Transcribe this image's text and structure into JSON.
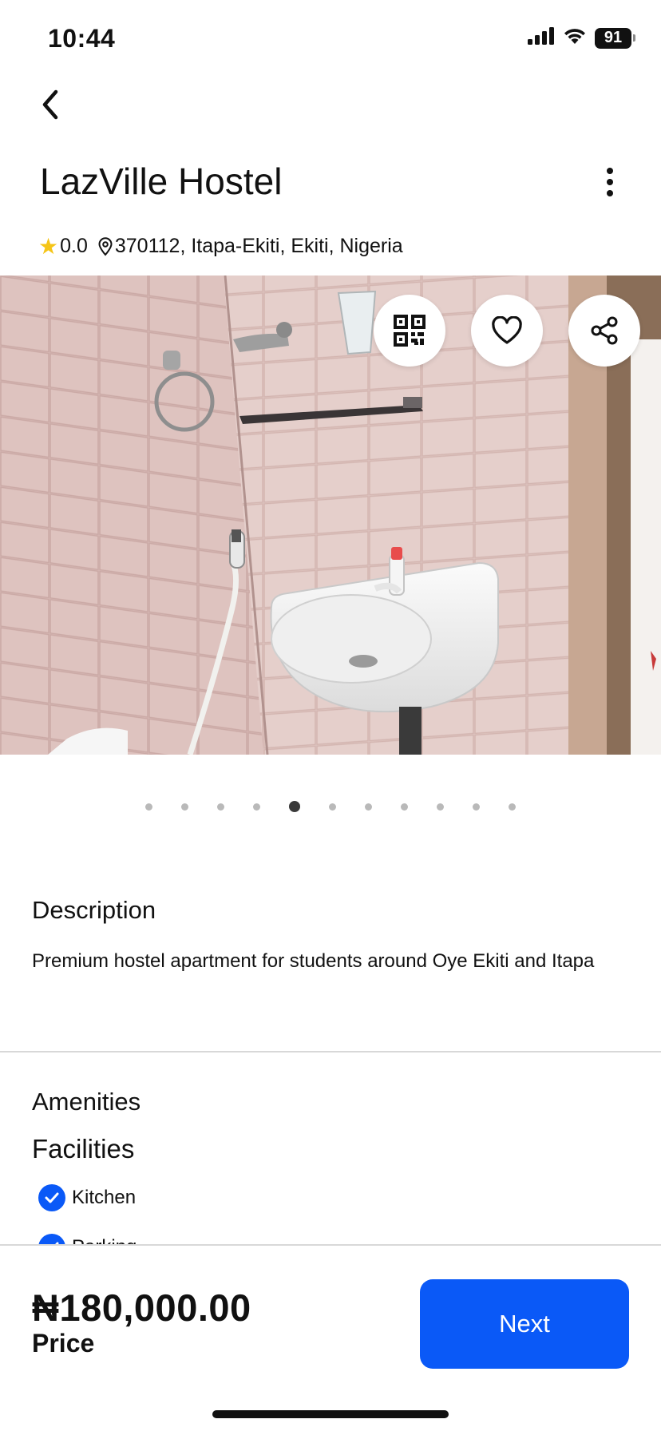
{
  "status_bar": {
    "time": "10:44",
    "battery": "91"
  },
  "header": {
    "title": "LazVille Hostel"
  },
  "meta": {
    "rating": "0.0",
    "address": "370112, Itapa-Ekiti, Ekiti, Nigeria"
  },
  "gallery": {
    "image_count": 11,
    "active_index": 4,
    "actions": [
      "qr-code-icon",
      "heart-icon",
      "share-icon"
    ]
  },
  "description": {
    "title": "Description",
    "text": "Premium hostel apartment for students around Oye Ekiti and Itapa"
  },
  "amenities": {
    "title": "Amenities",
    "facilities_title": "Facilities",
    "items": [
      "Kitchen",
      "Parking"
    ]
  },
  "footer": {
    "price": "₦180,000.00",
    "price_label": "Price",
    "next_label": "Next"
  },
  "colors": {
    "accent": "#0a59f7",
    "star": "#f5c518"
  }
}
